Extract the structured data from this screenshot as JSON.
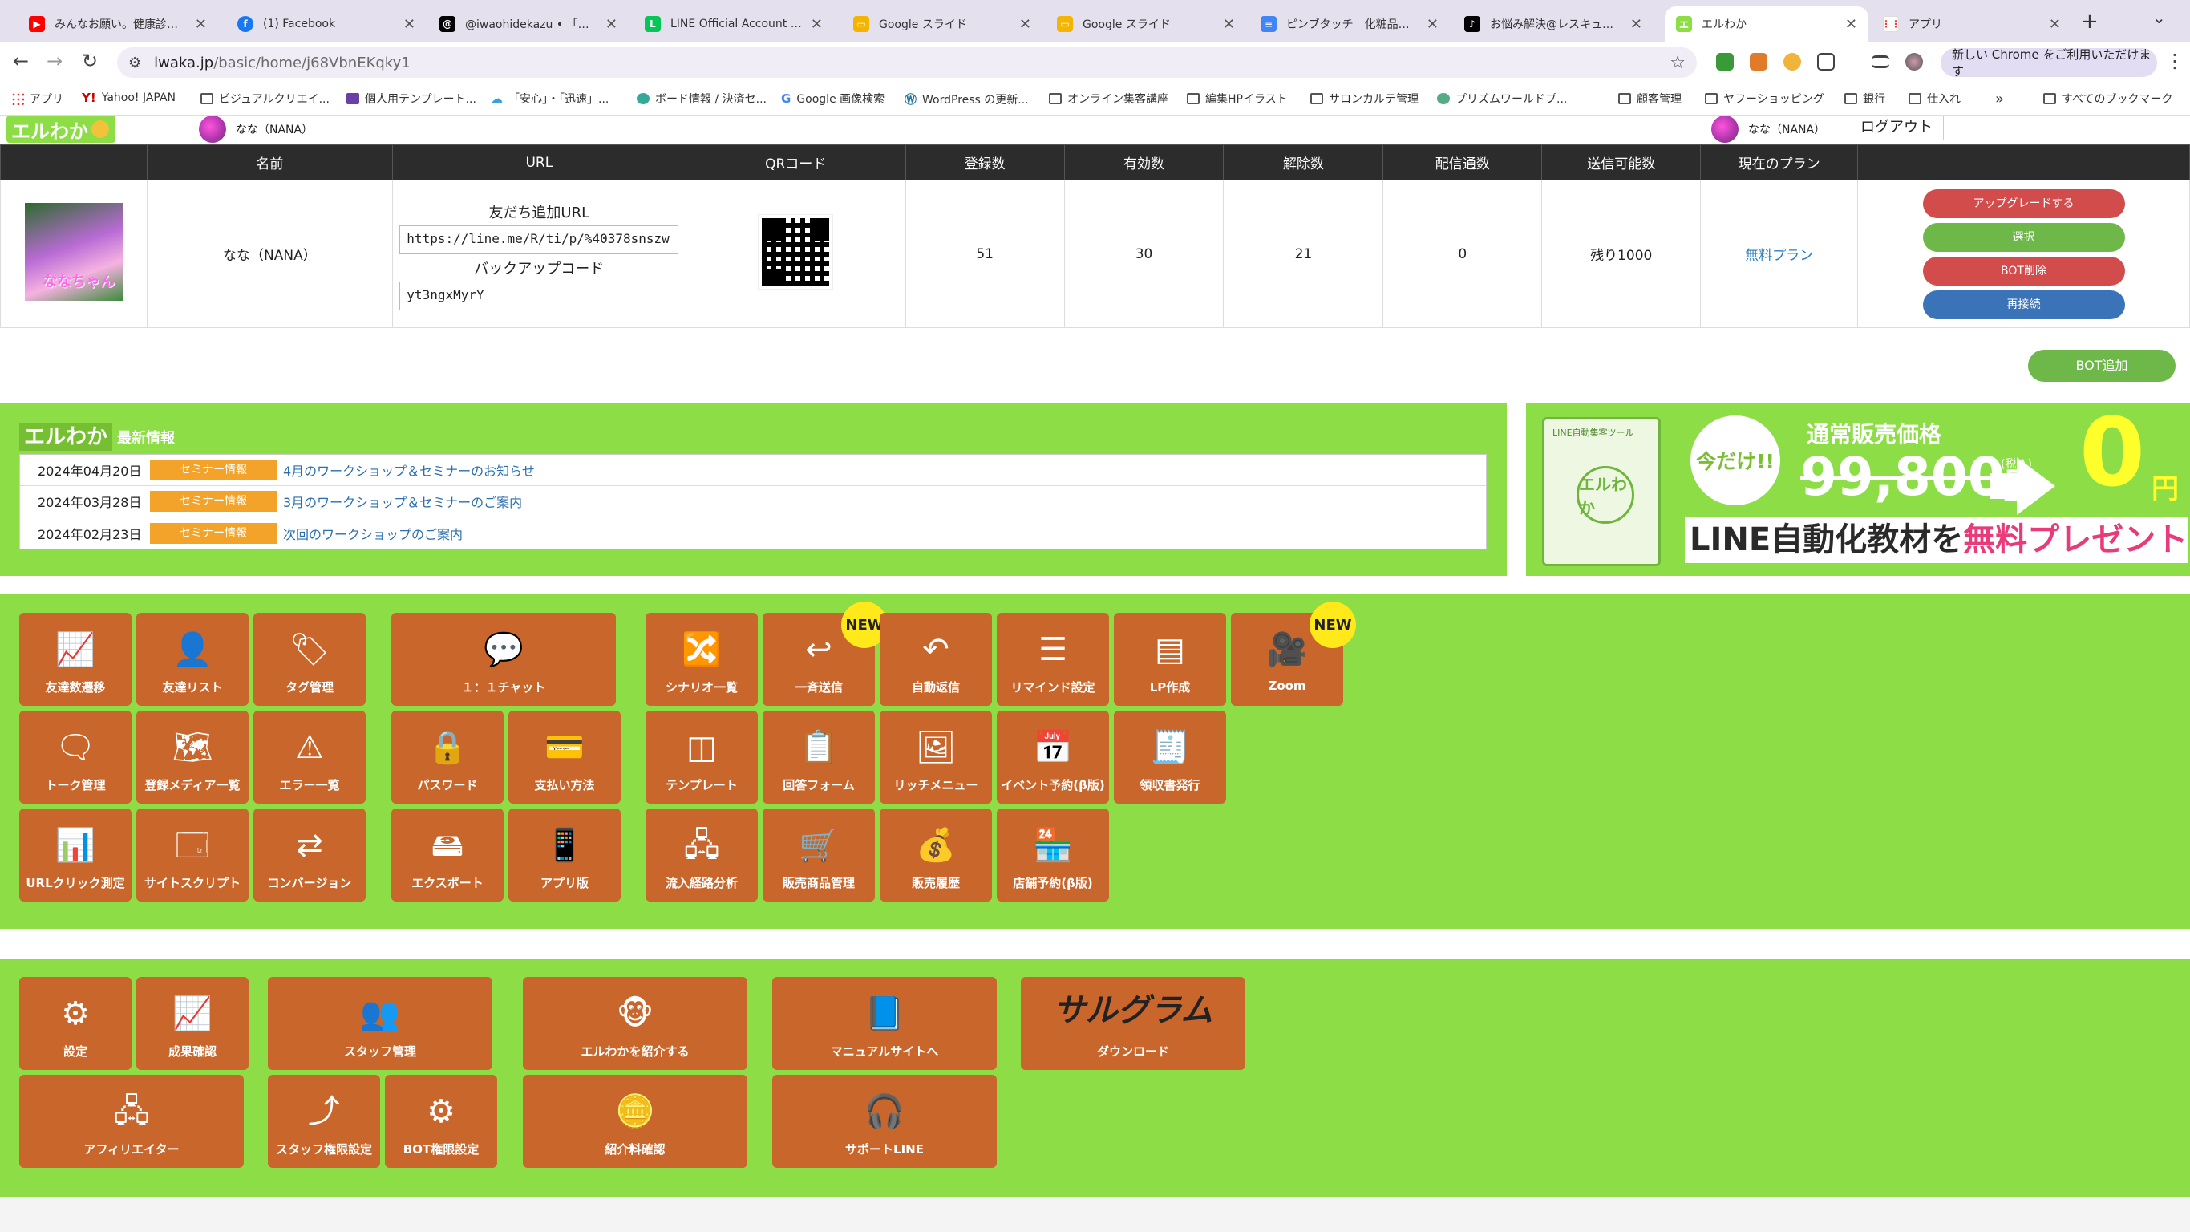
{
  "browser": {
    "tabs": [
      {
        "title": "みんなお願い。健康診断行こ",
        "icon": "youtube-icon",
        "color": "#ff0000"
      },
      {
        "title": "(1) Facebook",
        "icon": "facebook-icon",
        "color": "#1877f2"
      },
      {
        "title": "@iwaohidekazu • 「また",
        "icon": "threads-icon",
        "color": "#000000"
      },
      {
        "title": "LINE Official Account Ma",
        "icon": "line-icon",
        "color": "#06c755"
      },
      {
        "title": "Google スライド",
        "icon": "google-slides-icon",
        "color": "#f4b400"
      },
      {
        "title": "Google スライド",
        "icon": "google-slides-icon",
        "color": "#f4b400"
      },
      {
        "title": "ピンブタッチ　化粧品内容",
        "icon": "google-docs-icon",
        "color": "#4285f4"
      },
      {
        "title": "お悩み解決@レスキュー美",
        "icon": "tiktok-icon",
        "color": "#000000"
      },
      {
        "title": "エルわか",
        "icon": "lwaka-icon",
        "color": "#8ddd47"
      },
      {
        "title": "アプリ",
        "icon": "apps-grid-icon",
        "color": "#ea4335"
      }
    ],
    "active_tab": 8,
    "url_host": "lwaka.jp",
    "url_path": "/basic/home/j68VbnEKqky1",
    "chrome_promo": "新しい Chrome をご利用いただけます",
    "bookmarks": [
      "アプリ",
      "Yahoo! JAPAN",
      "ビジュアルクリエイ...",
      "個人用テンプレート...",
      "「安心」・「迅速」...",
      "ボード情報 / 決済セ...",
      "Google 画像検索",
      "WordPress の更新...",
      "オンライン集客講座",
      "編集HPイラスト",
      "サロンカルテ管理",
      "プリズムワールドプ...",
      "顧客管理",
      "ヤフーショッピング",
      "銀行",
      "仕入れ"
    ],
    "all_bookmarks": "すべてのブックマーク"
  },
  "header": {
    "logo": "エルわか",
    "account_name": "なな（NANA）",
    "logout": "ログアウト"
  },
  "bot_table": {
    "columns": [
      "名前",
      "URL",
      "QRコード",
      "登録数",
      "有効数",
      "解除数",
      "配信通数",
      "送信可能数",
      "現在のプラン"
    ],
    "row": {
      "avatar_caption": "ななちゃん",
      "name": "なな（NANA）",
      "friend_url_label": "友だち追加URL",
      "friend_url": "https://line.me/R/ti/p/%40378snszw",
      "backup_label": "バックアップコード",
      "backup_code": "yt3ngxMyrY",
      "registered": "51",
      "active": "30",
      "cancelled": "21",
      "deliveries": "0",
      "sendable": "残り1000",
      "plan": "無料プラン"
    },
    "actions": [
      {
        "label": "アップグレードする",
        "color": "#d24c4c"
      },
      {
        "label": "選択",
        "color": "#6eb84a"
      },
      {
        "label": "BOT削除",
        "color": "#d24c4c"
      },
      {
        "label": "再接続",
        "color": "#3a73b8"
      }
    ],
    "add_bot": "BOT追加"
  },
  "news": {
    "logo": "エルわか",
    "heading": "最新情報",
    "items": [
      {
        "date": "2024年04月20日",
        "tag": "セミナー情報",
        "title": "4月のワークショップ＆セミナーのお知らせ"
      },
      {
        "date": "2024年03月28日",
        "tag": "セミナー情報",
        "title": "3月のワークショップ＆セミナーのご案内"
      },
      {
        "date": "2024年02月23日",
        "tag": "セミナー情報",
        "title": "次回のワークショップのご案内"
      }
    ]
  },
  "banner": {
    "package_top": "LINE自動集客ツール",
    "package_logo": "エルわか",
    "limited": "今だけ!!",
    "regular_label": "通常販売価格",
    "regular_price": "99,800",
    "regular_unit": "円",
    "tax": "(税込)",
    "price": "0",
    "price_unit": "円",
    "tagline_a": "LINE自動化教材を",
    "tagline_b": "無料プレゼント"
  },
  "tools": [
    {
      "label": "友達数遷移",
      "icon": "line-chart-icon",
      "glyph": "📈"
    },
    {
      "label": "友達リスト",
      "icon": "user-icon",
      "glyph": "👤"
    },
    {
      "label": "タグ管理",
      "icon": "tags-icon",
      "glyph": "🏷"
    },
    {
      "label": "１：１チャット",
      "icon": "chat-bubble-icon",
      "glyph": "💬"
    },
    {
      "label": "シナリオ一覧",
      "icon": "shuffle-icon",
      "glyph": "🔀"
    },
    {
      "label": "一斉送信",
      "icon": "reply-icon",
      "glyph": "↩",
      "badge": "NEW"
    },
    {
      "label": "自動返信",
      "icon": "undo-icon",
      "glyph": "↶"
    },
    {
      "label": "リマインド設定",
      "icon": "list-icon",
      "glyph": "☰"
    },
    {
      "label": "LP作成",
      "icon": "webpage-icon",
      "glyph": "▤"
    },
    {
      "label": "Zoom",
      "icon": "video-camera-icon",
      "glyph": "🎥",
      "badge": "NEW"
    },
    {
      "label": "トーク管理",
      "icon": "comment-icon",
      "glyph": "🗨"
    },
    {
      "label": "登録メディア一覧",
      "icon": "map-icon",
      "glyph": "🗺"
    },
    {
      "label": "エラー一覧",
      "icon": "warning-icon",
      "glyph": "⚠"
    },
    {
      "label": "パスワード",
      "icon": "lock-icon",
      "glyph": "🔒"
    },
    {
      "label": "支払い方法",
      "icon": "credit-card-icon",
      "glyph": "💳"
    },
    {
      "label": "テンプレート",
      "icon": "columns-icon",
      "glyph": "◫"
    },
    {
      "label": "回答フォーム",
      "icon": "form-icon",
      "glyph": "📋"
    },
    {
      "label": "リッチメニュー",
      "icon": "image-icon",
      "glyph": "🖼"
    },
    {
      "label": "イベント予約(β版)",
      "icon": "calendar-icon",
      "glyph": "📅"
    },
    {
      "label": "領収書発行",
      "icon": "receipt-icon",
      "glyph": "🧾"
    },
    {
      "label": "URLクリック測定",
      "icon": "bar-chart-search-icon",
      "glyph": "📊"
    },
    {
      "label": "サイトスクリプト",
      "icon": "browser-window-icon",
      "glyph": "🗔"
    },
    {
      "label": "コンバージョン",
      "icon": "exchange-icon",
      "glyph": "⇄"
    },
    {
      "label": "エクスポート",
      "icon": "hard-drive-icon",
      "glyph": "🖴"
    },
    {
      "label": "アプリ版",
      "icon": "smartphone-icon",
      "glyph": "📱"
    },
    {
      "label": "流入経路分析",
      "icon": "sitemap-icon",
      "glyph": "🖧"
    },
    {
      "label": "販売商品管理",
      "icon": "shopping-cart-icon",
      "glyph": "🛒"
    },
    {
      "label": "販売履歴",
      "icon": "money-bag-icon",
      "glyph": "💰"
    },
    {
      "label": "店舗予約(β版)",
      "icon": "store-icon",
      "glyph": "🏪"
    }
  ],
  "settings": [
    {
      "label": "設定",
      "icon": "gears-icon",
      "glyph": "⚙"
    },
    {
      "label": "成果確認",
      "icon": "presentation-icon",
      "glyph": "📈"
    },
    {
      "label": "スタッフ管理",
      "icon": "group-icon",
      "glyph": "👥"
    },
    {
      "label": "エルわかを紹介する",
      "icon": "monkey-icon",
      "glyph": "🐵"
    },
    {
      "label": "マニュアルサイトへ",
      "icon": "book-icon",
      "glyph": "📘"
    },
    {
      "label": "ダウンロード",
      "icon": "sarugram-logo",
      "glyph": "サルグラム"
    },
    {
      "label": "アフィリエイター",
      "icon": "network-icon",
      "glyph": "🖧"
    },
    {
      "label": "スタッフ権限設定",
      "icon": "share-icon",
      "glyph": "⤴"
    },
    {
      "label": "BOT権限設定",
      "icon": "cog-icon",
      "glyph": "⚙"
    },
    {
      "label": "紹介料確認",
      "icon": "coins-icon",
      "glyph": "🪙"
    },
    {
      "label": "サポートLINE",
      "icon": "headset-icon",
      "glyph": "🎧"
    }
  ]
}
